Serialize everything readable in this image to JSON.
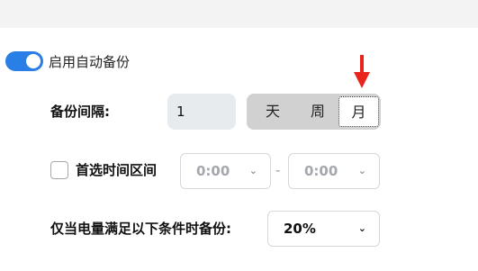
{
  "auto_backup": {
    "label": "启用自动备份",
    "enabled": true
  },
  "interval": {
    "label": "备份间隔:",
    "value": "1",
    "units": [
      "天",
      "周",
      "月"
    ],
    "selected_unit": "月"
  },
  "preferred_time": {
    "label": "首选时间区间",
    "checked": false,
    "start": "0:00",
    "separator": "-",
    "end": "0:00"
  },
  "battery": {
    "label": "仅当电量满足以下条件时备份:",
    "value": "20%"
  },
  "icons": {
    "chevron": "chevron-down-icon",
    "pointer": "red-arrow-down-icon"
  },
  "colors": {
    "toggle_on": "#2a7fe6",
    "segment_bg": "#d1d1d1",
    "arrow": "#e8241b"
  }
}
